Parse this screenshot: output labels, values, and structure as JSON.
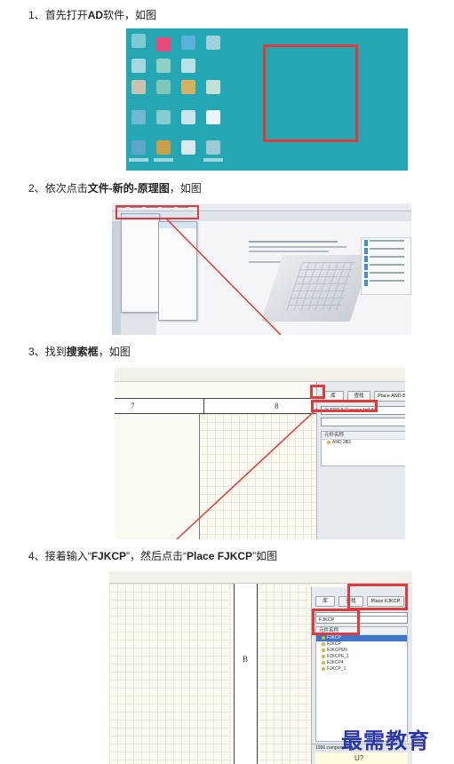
{
  "steps": [
    {
      "num": "1、",
      "pre": "首先打开",
      "bold": "AD",
      "mid": "软件，如图",
      "bold2": "",
      "post": ""
    },
    {
      "num": "2、",
      "pre": "依次点击",
      "bold": "文件-新的-原理图",
      "mid": "，如图",
      "bold2": "",
      "post": ""
    },
    {
      "num": "3、",
      "pre": "找到",
      "bold": "搜索框",
      "mid": "，如图",
      "bold2": "",
      "post": ""
    },
    {
      "num": "4、",
      "pre": "接着输入“",
      "bold": "FJKCP",
      "mid": "”，然后点击“",
      "bold2": "Place FJKCP",
      "post": "”如图"
    }
  ],
  "shot3": {
    "col_left": "7",
    "col_right": "8",
    "btn_lib": "库",
    "btn_search": "查找",
    "btn_place": "Place AND B",
    "lib_field": "FPGA Generic.IntLib",
    "list_header": "元件名称",
    "list_items": [
      "AND 2B3"
    ]
  },
  "shot4": {
    "col_label": "B",
    "btn_lib": "库",
    "btn_search": "查找",
    "btn_place": "Place FJKCP",
    "search_value": "FJKCP",
    "list_header": "元件名称",
    "list_items": [
      "FJKCP",
      "FJKCP",
      "FJKCPEN",
      "FJKCPE_1",
      "FJKCP4",
      "FJKCP_1"
    ],
    "footer": "1996 component",
    "comp_ref": "U?"
  },
  "watermark": "最需教育",
  "colors": {
    "highlight_box": "#e03a3a",
    "desktop_bg": "#24a7b3",
    "watermark": "#2a35a8"
  }
}
